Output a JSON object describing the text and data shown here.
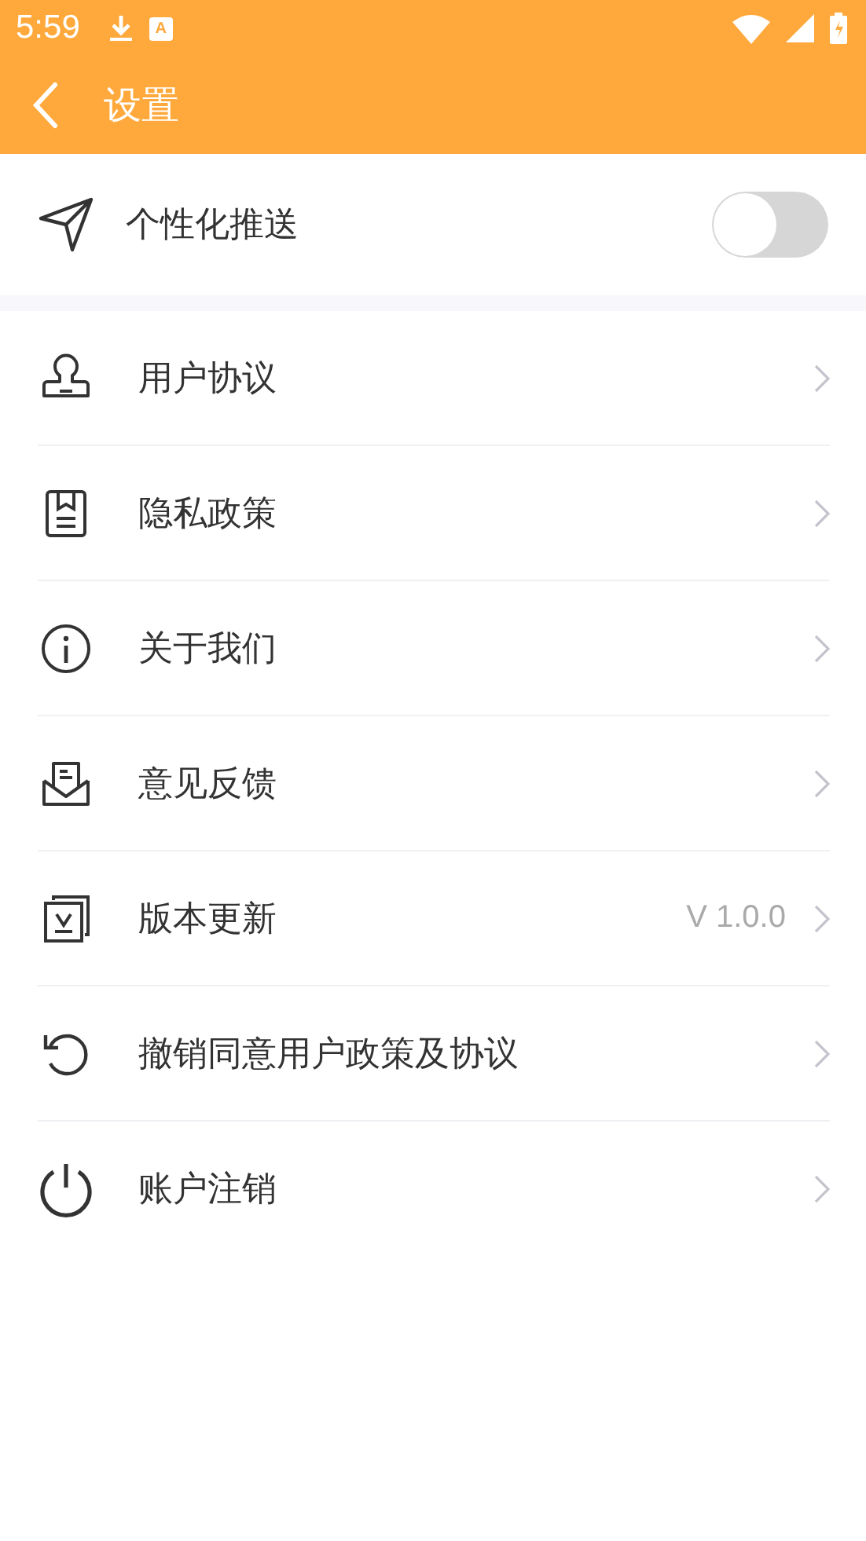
{
  "status_bar": {
    "time": "5:59",
    "badge_letter": "A"
  },
  "header": {
    "title": "设置"
  },
  "push_setting": {
    "label": "个性化推送",
    "on": false
  },
  "menu": [
    {
      "label": "用户协议"
    },
    {
      "label": "隐私政策"
    },
    {
      "label": "关于我们"
    },
    {
      "label": "意见反馈"
    },
    {
      "label": "版本更新",
      "value": "V 1.0.0"
    },
    {
      "label": "撤销同意用户政策及协议"
    },
    {
      "label": "账户注销"
    }
  ]
}
